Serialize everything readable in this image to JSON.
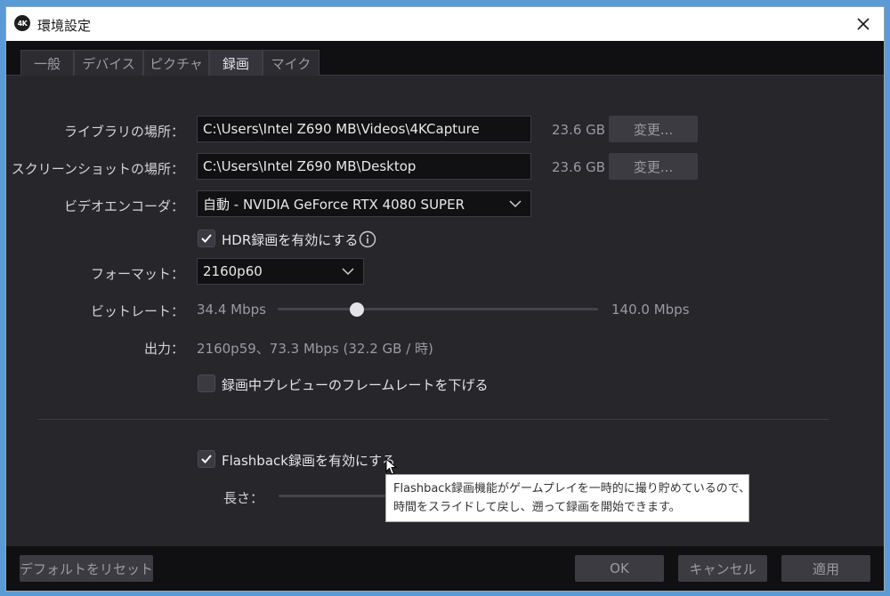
{
  "window": {
    "title": "環境設定",
    "app_badge": "4K"
  },
  "tabs": [
    {
      "label": "一般",
      "active": false
    },
    {
      "label": "デバイス",
      "active": false
    },
    {
      "label": "ピクチャ",
      "active": false
    },
    {
      "label": "録画",
      "active": true
    },
    {
      "label": "マイク",
      "active": false
    }
  ],
  "library": {
    "label": "ライブラリの場所：",
    "value": "C:\\Users\\Intel Z690 MB\\Videos\\4KCapture",
    "free": "23.6 GB",
    "change_label": "変更..."
  },
  "screenshot": {
    "label": "スクリーンショットの場所：",
    "value": "C:\\Users\\Intel Z690 MB\\Desktop",
    "free": "23.6 GB",
    "change_label": "変更..."
  },
  "encoder": {
    "label": "ビデオエンコーダ：",
    "value": "自動 - NVIDIA GeForce RTX 4080 SUPER"
  },
  "hdr": {
    "label": "HDR録画を有効にする",
    "checked": true
  },
  "format": {
    "label": "フォーマット：",
    "value": "2160p60"
  },
  "bitrate": {
    "label": "ビットレート：",
    "min": "34.4 Mbps",
    "max": "140.0 Mbps",
    "level": 0.247
  },
  "output": {
    "label": "出力：",
    "value": "2160p59、73.3 Mbps (32.2 GB / 時)"
  },
  "preview_fps": {
    "label": "録画中プレビューのフレームレートを下げる",
    "checked": false
  },
  "flashback": {
    "label": "Flashback録画を有効にする",
    "checked": true
  },
  "length": {
    "label": "長さ："
  },
  "tooltip": {
    "line1": "Flashback録画機能がゲームプレイを一時的に撮り貯めているので、",
    "line2": "時間をスライドして戻し、遡って録画を開始できます。"
  },
  "footer": {
    "reset_label": "デフォルトをリセット",
    "ok_label": "OK",
    "cancel_label": "キャンセル",
    "apply_label": "適用"
  },
  "colors": {
    "window_bg": "#26262b",
    "tabbar_bg": "#101012",
    "field_bg": "#111114",
    "button_bg": "#3b3b41",
    "desktop_bg": "#5b9bd5"
  }
}
